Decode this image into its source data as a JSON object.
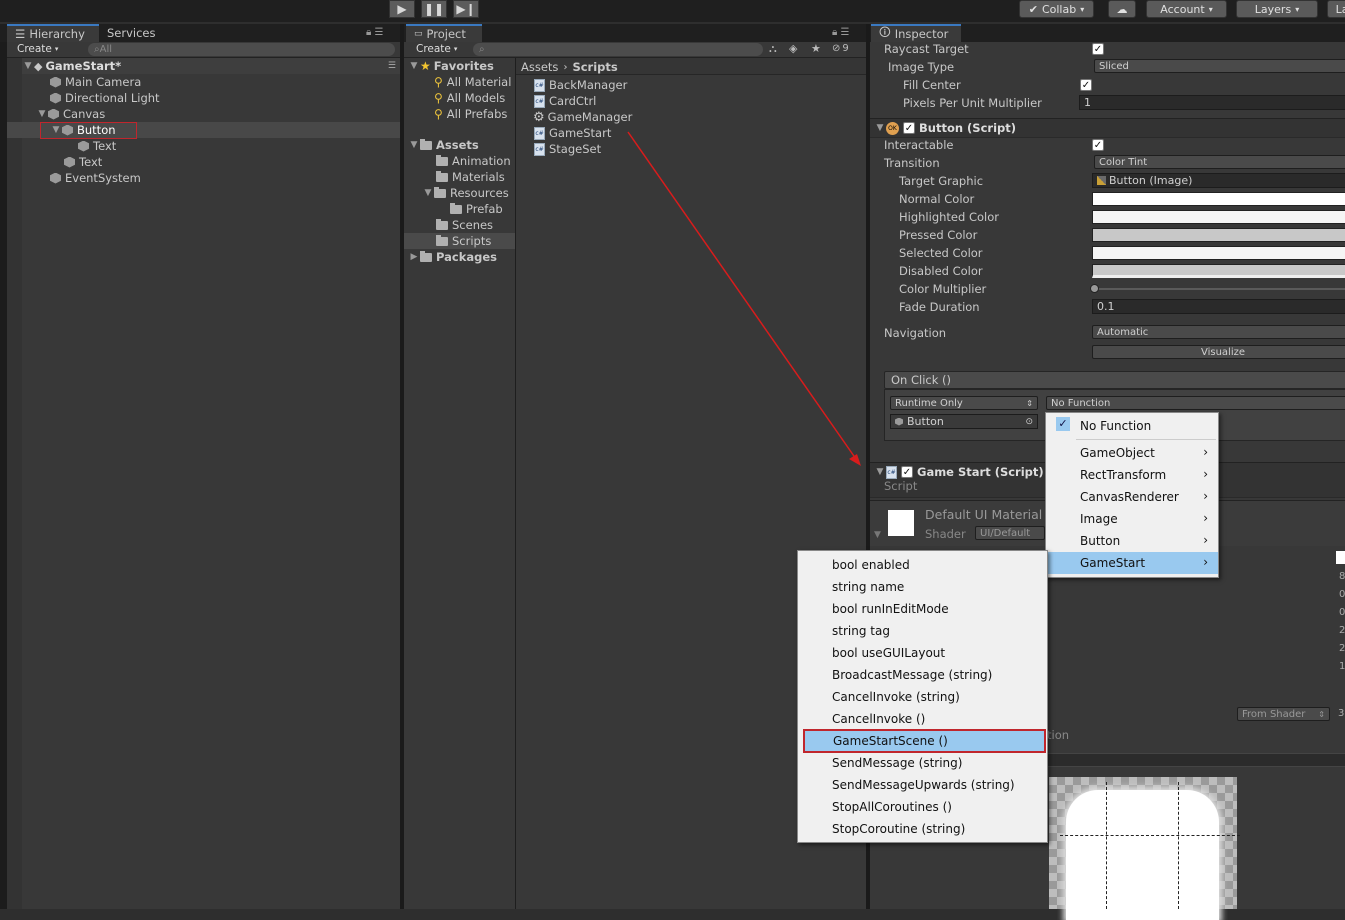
{
  "toolbar": {
    "collab_label": "Collab",
    "account_label": "Account",
    "layers_label": "Layers",
    "layout_label": "La"
  },
  "hierarchy": {
    "tab_label": "Hierarchy",
    "services_tab_label": "Services",
    "create_label": "Create",
    "search_placeholder": "All",
    "scene_name": "GameStart*",
    "items": [
      {
        "label": "Main Camera"
      },
      {
        "label": "Directional Light"
      },
      {
        "label": "Canvas"
      },
      {
        "label": "Button"
      },
      {
        "label": "Text"
      },
      {
        "label": "Text"
      },
      {
        "label": "EventSystem"
      }
    ]
  },
  "project": {
    "tab_label": "Project",
    "create_label": "Create",
    "hidden_count": "9",
    "favorites_label": "Favorites",
    "favorites": [
      "All Material",
      "All Models",
      "All Prefabs"
    ],
    "assets_label": "Assets",
    "folders": [
      "Animation",
      "Materials",
      "Resources",
      "Prefab",
      "Scenes",
      "Scripts"
    ],
    "packages_label": "Packages",
    "breadcrumb": {
      "root": "Assets",
      "current": "Scripts"
    },
    "files": [
      "BackManager",
      "CardCtrl",
      "GameManager",
      "GameStart",
      "StageSet"
    ]
  },
  "inspector": {
    "tab_label": "Inspector",
    "raycast_target_label": "Raycast Target",
    "image_type_label": "Image Type",
    "image_type_value": "Sliced",
    "fill_center_label": "Fill Center",
    "ppu_label": "Pixels Per Unit Multiplier",
    "ppu_value": "1",
    "button_script_label": "Button (Script)",
    "interactable_label": "Interactable",
    "transition_label": "Transition",
    "transition_value": "Color Tint",
    "target_graphic_label": "Target Graphic",
    "target_graphic_value": "Button (Image)",
    "normal_color_label": "Normal Color",
    "highlighted_color_label": "Highlighted Color",
    "pressed_color_label": "Pressed Color",
    "selected_color_label": "Selected Color",
    "disabled_color_label": "Disabled Color",
    "color_multiplier_label": "Color Multiplier",
    "fade_duration_label": "Fade Duration",
    "fade_duration_value": "0.1",
    "navigation_label": "Navigation",
    "navigation_value": "Automatic",
    "visualize_label": "Visualize",
    "on_click_label": "On Click ()",
    "runtime_only_label": "Runtime Only",
    "no_function_label": "No Function",
    "object_ref_label": "Button",
    "gamestart_script_label": "Game Start (Script)",
    "script_label": "Script",
    "material_name": "Default UI Material",
    "shader_label": "Shader",
    "shader_value": "UI/Default",
    "from_shader_label": "From Shader",
    "truncated_tion": "tion",
    "right_edge_digits": [
      "8",
      "0",
      "0",
      "2",
      "2",
      "1"
    ],
    "right_edge_digit_3": "3"
  },
  "component_menu": {
    "items": [
      {
        "label": "No Function",
        "checked": true
      },
      {
        "label": "GameObject",
        "submenu": true
      },
      {
        "label": "RectTransform",
        "submenu": true
      },
      {
        "label": "CanvasRenderer",
        "submenu": true
      },
      {
        "label": "Image",
        "submenu": true
      },
      {
        "label": "Button",
        "submenu": true
      },
      {
        "label": "GameStart",
        "submenu": true,
        "selected": true
      }
    ]
  },
  "function_menu": {
    "items": [
      {
        "label": "bool enabled"
      },
      {
        "label": "string name"
      },
      {
        "label": "bool runInEditMode"
      },
      {
        "label": "string tag"
      },
      {
        "label": "bool useGUILayout"
      },
      {
        "label": "BroadcastMessage (string)"
      },
      {
        "label": "CancelInvoke (string)"
      },
      {
        "label": "CancelInvoke ()"
      },
      {
        "label": "GameStartScene ()",
        "selected": true
      },
      {
        "label": "SendMessage (string)"
      },
      {
        "label": "SendMessageUpwards (string)"
      },
      {
        "label": "StopAllCoroutines ()"
      },
      {
        "label": "StopCoroutine (string)"
      }
    ]
  },
  "colors": {
    "accent_blue": "#3a79c1",
    "menu_selected": "#99c9ef",
    "highlight_box": "#c0262d",
    "arrow": "#d81c1c"
  }
}
